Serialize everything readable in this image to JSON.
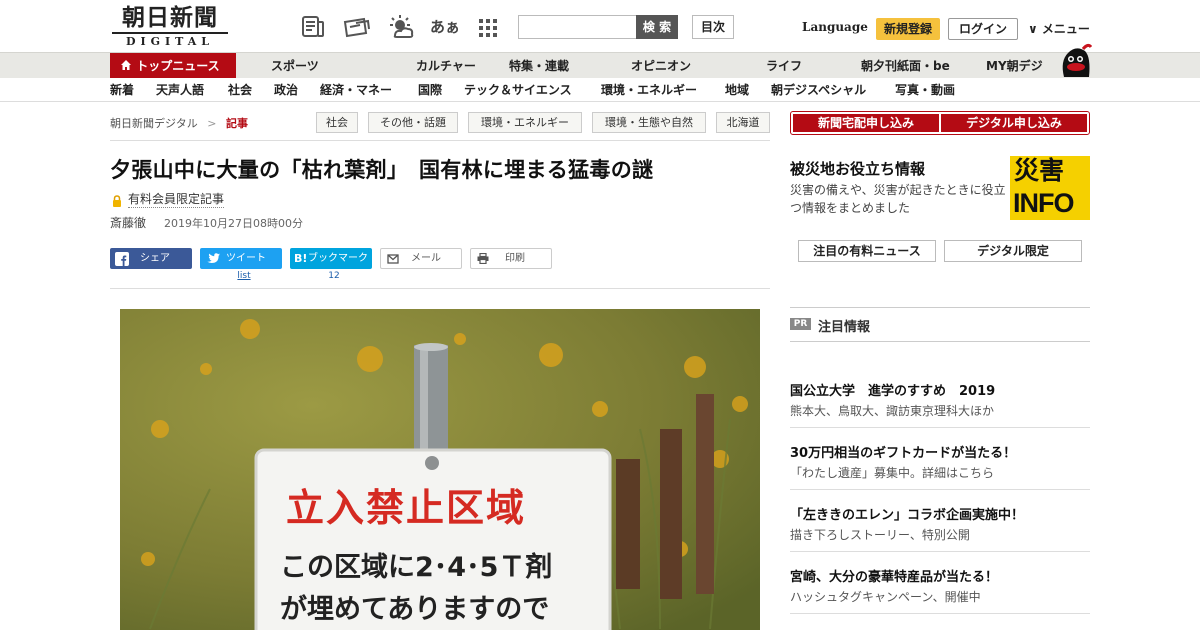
{
  "header": {
    "logo_main": "朝日新聞",
    "logo_sub": "DIGITAL",
    "icons": [
      "newspaper-icon",
      "ticket-icon",
      "weather-icon",
      "font-size-icon",
      "grid-icon"
    ],
    "font_icon_text": "あぁ",
    "search_button": "検 索",
    "toc_button": "目次",
    "language": "Language",
    "signup": "新規登録",
    "login": "ログイン",
    "menu": "∨ メニュー"
  },
  "nav1": [
    "トップニュース",
    "スポーツ",
    "カルチャー",
    "特集・連載",
    "オピニオン",
    "ライフ",
    "朝夕刊紙面・be",
    "MY朝デジ"
  ],
  "nav2": [
    "新着",
    "天声人語",
    "社会",
    "政治",
    "経済・マネー",
    "国際",
    "テック＆サイエンス",
    "環境・エネルギー",
    "地域",
    "朝デジスペシャル",
    "写真・動画"
  ],
  "breadcrumb": {
    "home": "朝日新聞デジタル",
    "sep": ">",
    "current": "記事"
  },
  "tags": [
    "社会",
    "その他・話題",
    "環境・エネルギー",
    "環境・生態や自然",
    "北海道"
  ],
  "article": {
    "title": "夕張山中に大量の「枯れ葉剤」　国有林に埋まる猛毒の謎",
    "member_label": "有料会員限定記事",
    "author": "斎藤徹",
    "date": "2019年10月27日08時00分"
  },
  "share": {
    "facebook": "シェア",
    "twitter": "ツイート",
    "hatena_logo": "B!",
    "hatena": "ブックマーク",
    "mail": "メール",
    "print": "印刷",
    "twitter_count": "list",
    "hatena_count": "12"
  },
  "photo": {
    "sign_line1": "立入禁止区域",
    "sign_line2": "この区域に2･4･5Ｔ剤",
    "sign_line3": "が埋めてありますので"
  },
  "sidebar": {
    "subscribe_paper": "新聞宅配申し込み",
    "subscribe_digital": "デジタル申し込み",
    "disaster_title": "被災地お役立ち情報",
    "disaster_desc": "災害の備えや、災害が起きたときに役立つ情報をまとめました",
    "info_top": "災害",
    "info_bottom": "INFO",
    "tab_paid": "注目の有料ニュース",
    "tab_digital": "デジタル限定",
    "pr": "PR",
    "attention": "注目情報",
    "ads": [
      {
        "title": "国公立大学　進学のすすめ　2019",
        "sub": "熊本大、鳥取大、諏訪東京理科大ほか"
      },
      {
        "title": "30万円相当のギフトカードが当たる！",
        "sub": "「わたし遺産」募集中。詳細はこちら"
      },
      {
        "title": "「左ききのエレン」コラボ企画実施中！",
        "sub": "描き下ろしストーリー、特別公開"
      },
      {
        "title": "宮崎、大分の豪華特産品が当たる！",
        "sub": "ハッシュタグキャンペーン、開催中"
      }
    ]
  },
  "colors": {
    "brand_red": "#b40b14",
    "signup_yellow": "#f5c13d",
    "facebook": "#3b5998",
    "twitter": "#1da1f2",
    "hatena": "#00a4de",
    "info_yellow": "#f5d000"
  }
}
